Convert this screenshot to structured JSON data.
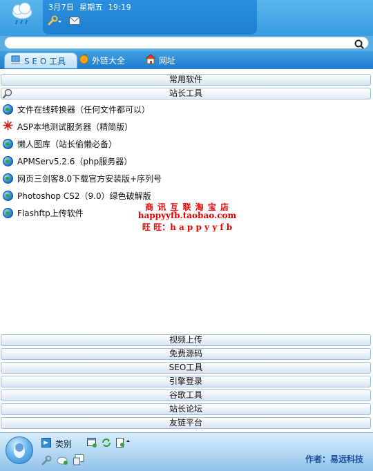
{
  "header": {
    "date": "3月7日",
    "weekday": "星期五",
    "time": "19:19"
  },
  "search": {
    "value": "",
    "placeholder": ""
  },
  "tabs": [
    {
      "label": "S E O 工具",
      "active": true,
      "icon": "laptop-icon"
    },
    {
      "label": "外链大全",
      "active": false,
      "icon": "orange-ball-icon"
    },
    {
      "label": "网址",
      "active": false,
      "icon": "house-icon"
    }
  ],
  "sections_top": [
    "常用软件",
    "站长工具"
  ],
  "items": [
    {
      "label": "文件在线转换器（任何文件都可以）",
      "icon": "globe-icon"
    },
    {
      "label": "ASP本地测试服务器（精简版）",
      "icon": "virus-icon"
    },
    {
      "label": "懒人图库（站长偷懒必备）",
      "icon": "globe-icon"
    },
    {
      "label": "APMServ5.2.6（php服务器）",
      "icon": "globe-icon"
    },
    {
      "label": "网页三剑客8.0下载官方安装版+序列号",
      "icon": "globe-icon"
    },
    {
      "label": " Photoshop CS2（9.0）绿色破解版",
      "icon": "globe-icon"
    },
    {
      "label": "Flashftp上传软件",
      "icon": "globe-icon"
    }
  ],
  "watermark": {
    "line1": "商 讯 互 联 淘 宝 店",
    "line2": "happyyfb.taobao.com",
    "line3": "旺 旺：h a p p y y f b"
  },
  "sections_bottom": [
    "视频上传",
    "免费源码",
    "SEO工具",
    "引擎登录",
    "谷歌工具",
    "站长论坛",
    "友链平台"
  ],
  "footer": {
    "category_label": "类别",
    "author": "作者：易远科技"
  },
  "colors": {
    "accent": "#2a8fdd",
    "watermark": "#e00000",
    "author": "#1c4fa0"
  }
}
